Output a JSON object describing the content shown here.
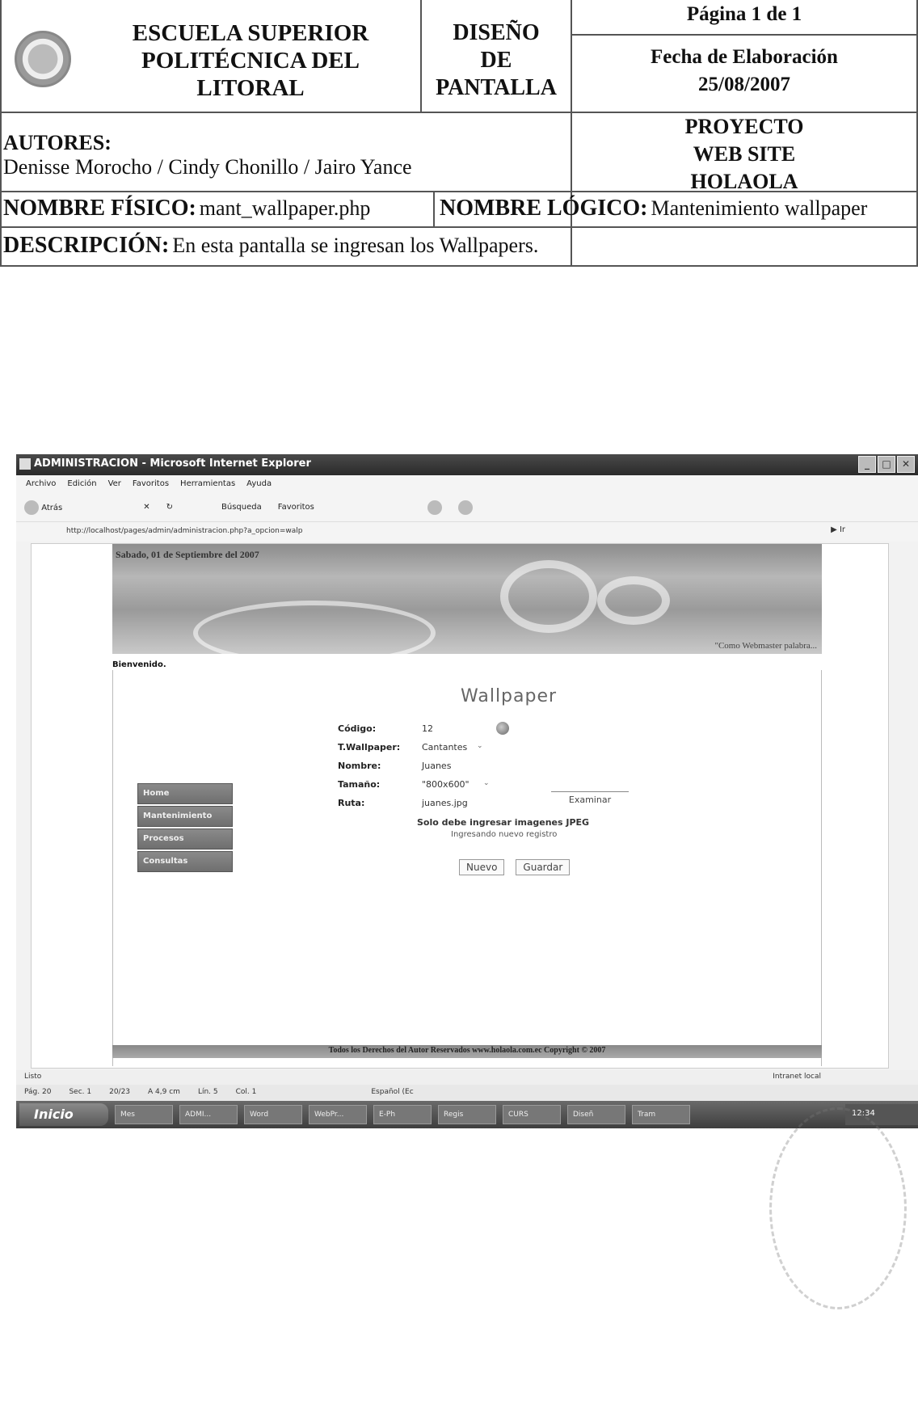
{
  "header": {
    "school_name": [
      "ESCUELA SUPERIOR",
      "POLITÉCNICA DEL",
      "LITORAL"
    ],
    "design_title": [
      "DISEÑO",
      "DE",
      "PANTALLA"
    ],
    "page_info": "Página 1 de 1",
    "date_label": "Fecha de Elaboración",
    "date_value": "25/08/2007",
    "authors_label": "AUTORES:",
    "authors_names": "Denisse Morocho  / Cindy Chonillo / Jairo Yance",
    "project": [
      "PROYECTO",
      "WEB SITE",
      "HOLAOLA"
    ],
    "physical_name_label": "NOMBRE FÍSICO:",
    "physical_name_value": "mant_wallpaper.php",
    "logical_name_label": "NOMBRE LÓGICO:",
    "logical_name_value": "Mantenimiento wallpaper",
    "description_label": "DESCRIPCIÓN:",
    "description_value": "En esta pantalla se ingresan los Wallpapers."
  },
  "browser": {
    "window_title": "ADMINISTRACION - Microsoft Internet Explorer",
    "menu": [
      "Archivo",
      "Edición",
      "Ver",
      "Favoritos",
      "Herramientas",
      "Ayuda"
    ],
    "toolbar": {
      "back": "Atrás",
      "search": "Búsqueda",
      "favorites": "Favoritos"
    },
    "address": "http://localhost/pages/admin/administracion.php?a_opcion=walp",
    "go": "Ir",
    "status_left": "Listo",
    "status_zone": "Intranet local"
  },
  "site": {
    "banner_date": "Sabado, 01 de Septiembre del 2007",
    "banner_tagline": "\"Como Webmaster palabra...",
    "welcome": "Bienvenido.",
    "page_title": "Wallpaper",
    "menu": [
      "Home",
      "Mantenimiento",
      "Procesos",
      "Consultas"
    ],
    "form": {
      "codigo_label": "Código:",
      "codigo_value": "12",
      "tipo_label": "T.Wallpaper:",
      "tipo_value": "Cantantes",
      "nombre_label": "Nombre:",
      "nombre_value": "Juanes",
      "tamano_label": "Tamaño:",
      "tamano_value": "\"800x600\"",
      "ruta_label": "Ruta:",
      "ruta_value": "juanes.jpg",
      "examinar": "Examinar"
    },
    "note": "Solo debe ingresar imagenes JPEG",
    "status_msg": "Ingresando nuevo registro",
    "btn_new": "Nuevo",
    "btn_save": "Guardar",
    "footer": "Todos los Derechos del Autor Reservados www.holaola.com.ec Copyright © 2007"
  },
  "word_status": {
    "page": "Pág. 20",
    "section": "Sec. 1",
    "pages": "20/23",
    "at": "A 4,9 cm",
    "line": "Lín. 5",
    "col": "Col. 1",
    "lang": "Español (Ec"
  },
  "taskbar": {
    "start": "Inicio",
    "items": [
      "Mes",
      "ADMI...",
      "Word",
      "WebPr...",
      "E-Ph",
      "Regis",
      "CURS",
      "Diseñ",
      "Tram"
    ],
    "clock": "12:34"
  }
}
